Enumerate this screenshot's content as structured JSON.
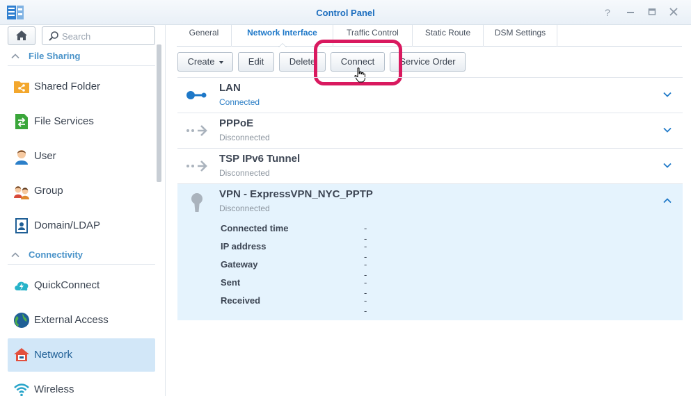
{
  "window": {
    "title": "Control Panel",
    "controls": [
      "help-icon",
      "minimize-icon",
      "maximize-icon",
      "close-icon"
    ]
  },
  "sidebar": {
    "search_placeholder": "Search",
    "sections": [
      {
        "label": "File Sharing",
        "items": [
          {
            "label": "Shared Folder",
            "icon": "shared-folder-icon"
          },
          {
            "label": "File Services",
            "icon": "file-services-icon"
          },
          {
            "label": "User",
            "icon": "user-icon"
          },
          {
            "label": "Group",
            "icon": "group-icon"
          },
          {
            "label": "Domain/LDAP",
            "icon": "domain-ldap-icon"
          }
        ]
      },
      {
        "label": "Connectivity",
        "items": [
          {
            "label": "QuickConnect",
            "icon": "quickconnect-icon"
          },
          {
            "label": "External Access",
            "icon": "external-access-icon"
          },
          {
            "label": "Network",
            "icon": "network-icon",
            "selected": true
          },
          {
            "label": "Wireless",
            "icon": "wireless-icon"
          }
        ]
      }
    ]
  },
  "tabs": [
    {
      "label": "General"
    },
    {
      "label": "Network Interface",
      "active": true
    },
    {
      "label": "Traffic Control"
    },
    {
      "label": "Static Route"
    },
    {
      "label": "DSM Settings"
    }
  ],
  "toolbar": {
    "create": "Create",
    "edit": "Edit",
    "delete": "Delete",
    "connect": "Connect",
    "service_order": "Service Order"
  },
  "interfaces": [
    {
      "name": "LAN",
      "status": "Connected",
      "icon": "lan-icon",
      "expanded": false
    },
    {
      "name": "PPPoE",
      "status": "Disconnected",
      "icon": "pppoe-icon",
      "expanded": false
    },
    {
      "name": "TSP IPv6 Tunnel",
      "status": "Disconnected",
      "icon": "tunnel-icon",
      "expanded": false
    },
    {
      "name": "VPN - ExpressVPN_NYC_PPTP",
      "status": "Disconnected",
      "icon": "vpn-icon",
      "expanded": true,
      "details": [
        {
          "key": "Connected time",
          "value": "--"
        },
        {
          "key": "IP address",
          "value": "--"
        },
        {
          "key": "Gateway",
          "value": "--"
        },
        {
          "key": "Sent",
          "value": "--"
        },
        {
          "key": "Received",
          "value": "--"
        }
      ]
    }
  ],
  "colors": {
    "accent": "#1e78c8",
    "highlight": "#d9195f",
    "selected_bg": "#d2e7f8",
    "expanded_bg": "#e5f3fd"
  }
}
